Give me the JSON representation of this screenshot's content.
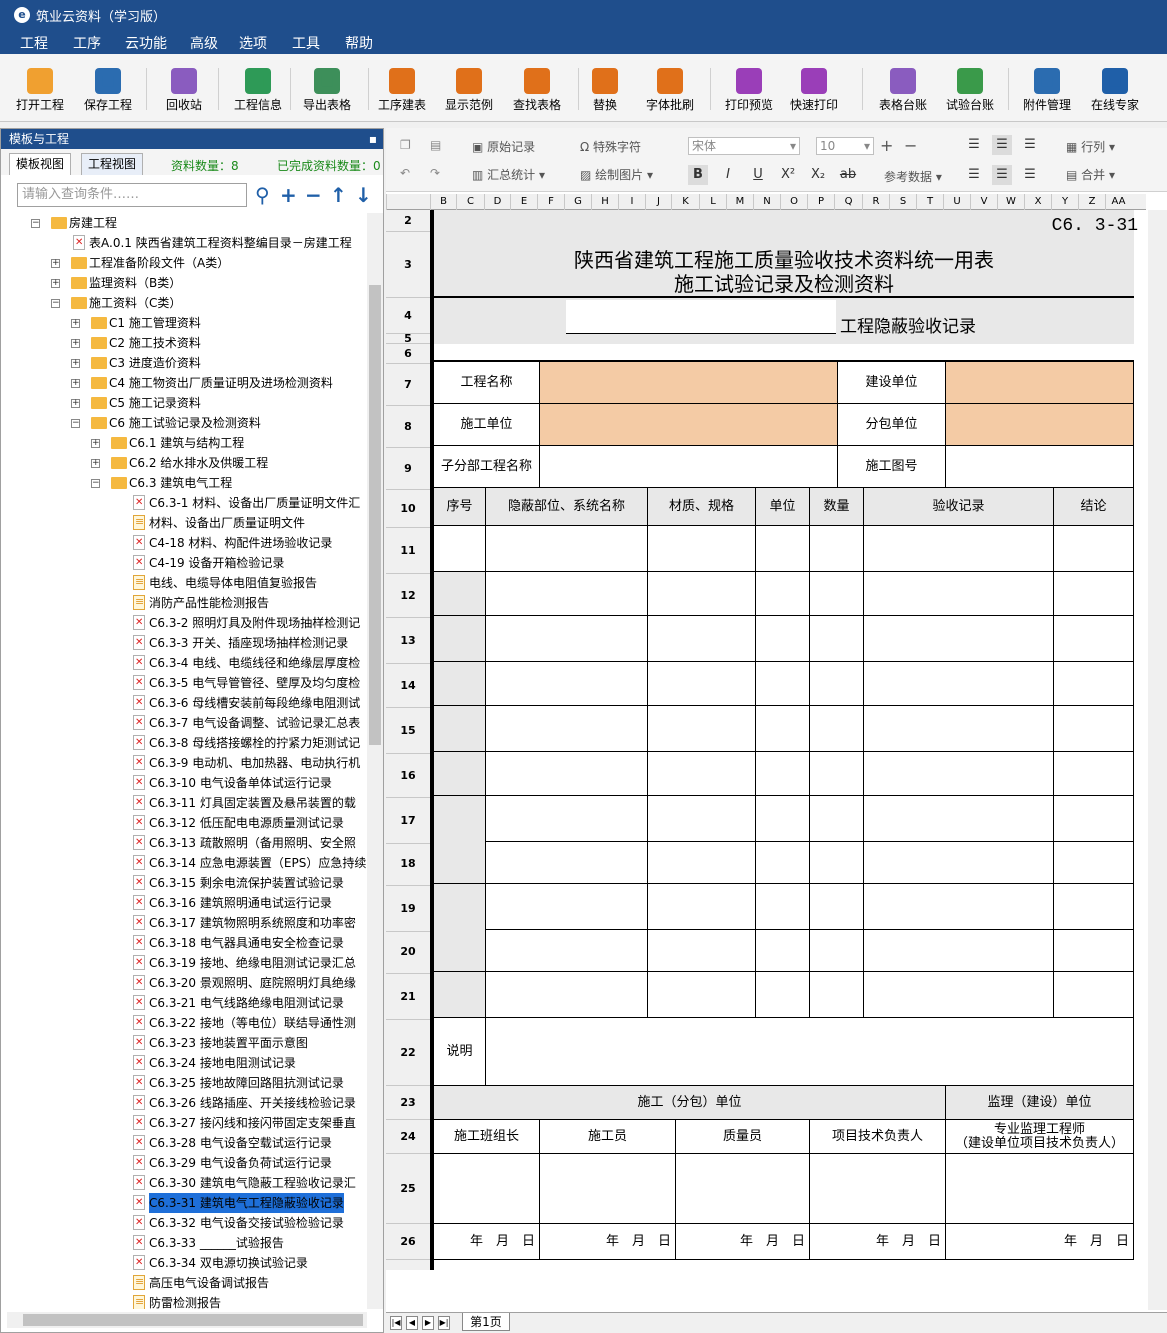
{
  "app_title": "筑业云资料（学习版）",
  "menu": [
    "工程",
    "工序",
    "云功能",
    "高级",
    "选项",
    "工具",
    "帮助"
  ],
  "toolbar": [
    {
      "label": "打开工程",
      "icon": "folder-open-icon",
      "color": "#f0a030"
    },
    {
      "label": "保存工程",
      "icon": "save-icon",
      "color": "#2b6cb0"
    },
    {
      "label": "回收站",
      "icon": "trash-icon",
      "color": "#8a5cbf"
    },
    {
      "label": "工程信息",
      "icon": "info-icon",
      "color": "#2e9a57"
    },
    {
      "label": "导出表格",
      "icon": "export-icon",
      "color": "#3d8f5a"
    },
    {
      "label": "工序建表",
      "icon": "layers-icon",
      "color": "#e0701a"
    },
    {
      "label": "显示范例",
      "icon": "example-icon",
      "color": "#e0701a"
    },
    {
      "label": "查找表格",
      "icon": "search-table-icon",
      "color": "#e0701a"
    },
    {
      "label": "替换",
      "icon": "replace-icon",
      "color": "#e0701a"
    },
    {
      "label": "字体批刷",
      "icon": "font-brush-icon",
      "color": "#e0701a"
    },
    {
      "label": "打印预览",
      "icon": "preview-icon",
      "color": "#9a3eb8"
    },
    {
      "label": "快速打印",
      "icon": "print-icon",
      "color": "#9a3eb8"
    },
    {
      "label": "表格台账",
      "icon": "ledger-icon",
      "color": "#8a5cbf"
    },
    {
      "label": "试验台账",
      "icon": "test-ledger-icon",
      "color": "#3a9a4a"
    },
    {
      "label": "附件管理",
      "icon": "attachment-icon",
      "color": "#2b6cb0"
    },
    {
      "label": "在线专家",
      "icon": "expert-icon",
      "color": "#1f5fa8"
    }
  ],
  "left_panel": {
    "title": "模板与工程",
    "tabs": [
      "模板视图",
      "工程视图"
    ],
    "count1": "资料数量：8",
    "count2": "已完成资料数量：0",
    "search_placeholder": "请输入查询条件……"
  },
  "tree": [
    {
      "lvl": 2,
      "type": "folder",
      "exp": "−",
      "text": "房建工程"
    },
    {
      "lvl": 3,
      "type": "docx",
      "text": "表A.0.1 陕西省建筑工程资料整编目录－房建工程"
    },
    {
      "lvl": 3,
      "type": "folder",
      "exp": "+",
      "text": "工程准备阶段文件（A类）"
    },
    {
      "lvl": 3,
      "type": "folder",
      "exp": "+",
      "text": "监理资料（B类）"
    },
    {
      "lvl": 3,
      "type": "folder",
      "exp": "−",
      "text": "施工资料（C类）"
    },
    {
      "lvl": 4,
      "type": "folder",
      "exp": "+",
      "text": "C1 施工管理资料"
    },
    {
      "lvl": 4,
      "type": "folder",
      "exp": "+",
      "text": "C2 施工技术资料"
    },
    {
      "lvl": 4,
      "type": "folder",
      "exp": "+",
      "text": "C3 进度造价资料"
    },
    {
      "lvl": 4,
      "type": "folder",
      "exp": "+",
      "text": "C4 施工物资出厂质量证明及进场检测资料"
    },
    {
      "lvl": 4,
      "type": "folder",
      "exp": "+",
      "text": "C5 施工记录资料"
    },
    {
      "lvl": 4,
      "type": "folder",
      "exp": "−",
      "text": "C6 施工试验记录及检测资料"
    },
    {
      "lvl": 5,
      "type": "folder",
      "exp": "+",
      "text": "C6.1 建筑与结构工程"
    },
    {
      "lvl": 5,
      "type": "folder",
      "exp": "+",
      "text": "C6.2 给水排水及供暖工程"
    },
    {
      "lvl": 5,
      "type": "folder",
      "exp": "−",
      "text": "C6.3 建筑电气工程"
    },
    {
      "lvl": 6,
      "type": "docx",
      "text": "C6.3-1 材料、设备出厂质量证明文件汇"
    },
    {
      "lvl": 6,
      "type": "docy",
      "text": "材料、设备出厂质量证明文件"
    },
    {
      "lvl": 6,
      "type": "docx",
      "text": "C4-18 材料、构配件进场验收记录"
    },
    {
      "lvl": 6,
      "type": "docx",
      "text": "C4-19 设备开箱检验记录"
    },
    {
      "lvl": 6,
      "type": "docy",
      "text": "电线、电缆导体电阻值复验报告"
    },
    {
      "lvl": 6,
      "type": "docy",
      "text": "消防产品性能检测报告"
    },
    {
      "lvl": 6,
      "type": "docx",
      "text": "C6.3-2 照明灯具及附件现场抽样检测记"
    },
    {
      "lvl": 6,
      "type": "docx",
      "text": "C6.3-3 开关、插座现场抽样检测记录"
    },
    {
      "lvl": 6,
      "type": "docx",
      "text": "C6.3-4 电线、电缆线径和绝缘层厚度检"
    },
    {
      "lvl": 6,
      "type": "docx",
      "text": "C6.3-5 电气导管管径、壁厚及均匀度检"
    },
    {
      "lvl": 6,
      "type": "docx",
      "text": "C6.3-6 母线槽安装前每段绝缘电阻测试"
    },
    {
      "lvl": 6,
      "type": "docx",
      "text": "C6.3-7 电气设备调整、试验记录汇总表"
    },
    {
      "lvl": 6,
      "type": "docx",
      "text": "C6.3-8 母线搭接螺栓的拧紧力矩测试记"
    },
    {
      "lvl": 6,
      "type": "docx",
      "text": "C6.3-9 电动机、电加热器、电动执行机"
    },
    {
      "lvl": 6,
      "type": "docx",
      "text": "C6.3-10 电气设备单体试运行记录"
    },
    {
      "lvl": 6,
      "type": "docx",
      "text": "C6.3-11 灯具固定装置及悬吊装置的载"
    },
    {
      "lvl": 6,
      "type": "docx",
      "text": "C6.3-12 低压配电电源质量测试记录"
    },
    {
      "lvl": 6,
      "type": "docx",
      "text": "C6.3-13 疏散照明（备用照明、安全照"
    },
    {
      "lvl": 6,
      "type": "docx",
      "text": "C6.3-14 应急电源装置（EPS）应急持续"
    },
    {
      "lvl": 6,
      "type": "docx",
      "text": "C6.3-15 剩余电流保护装置试验记录"
    },
    {
      "lvl": 6,
      "type": "docx",
      "text": "C6.3-16 建筑照明通电试运行记录"
    },
    {
      "lvl": 6,
      "type": "docx",
      "text": "C6.3-17 建筑物照明系统照度和功率密"
    },
    {
      "lvl": 6,
      "type": "docx",
      "text": "C6.3-18 电气器具通电安全检查记录"
    },
    {
      "lvl": 6,
      "type": "docx",
      "text": "C6.3-19 接地、绝缘电阻测试记录汇总"
    },
    {
      "lvl": 6,
      "type": "docx",
      "text": "C6.3-20 景观照明、庭院照明灯具绝缘"
    },
    {
      "lvl": 6,
      "type": "docx",
      "text": "C6.3-21 电气线路绝缘电阻测试记录"
    },
    {
      "lvl": 6,
      "type": "docx",
      "text": "C6.3-22 接地（等电位）联结导通性测"
    },
    {
      "lvl": 6,
      "type": "docx",
      "text": "C6.3-23 接地装置平面示意图"
    },
    {
      "lvl": 6,
      "type": "docx",
      "text": "C6.3-24 接地电阻测试记录"
    },
    {
      "lvl": 6,
      "type": "docx",
      "text": "C6.3-25 接地故障回路阻抗测试记录"
    },
    {
      "lvl": 6,
      "type": "docx",
      "text": "C6.3-26 线路插座、开关接线检验记录"
    },
    {
      "lvl": 6,
      "type": "docx",
      "text": "C6.3-27 接闪线和接闪带固定支架垂直"
    },
    {
      "lvl": 6,
      "type": "docx",
      "text": "C6.3-28 电气设备空载试运行记录"
    },
    {
      "lvl": 6,
      "type": "docx",
      "text": "C6.3-29 电气设备负荷试运行记录"
    },
    {
      "lvl": 6,
      "type": "docx",
      "text": "C6.3-30 建筑电气隐蔽工程验收记录汇"
    },
    {
      "lvl": 6,
      "type": "docx",
      "text": "C6.3-31 建筑电气工程隐蔽验收记录",
      "selected": true
    },
    {
      "lvl": 6,
      "type": "docx",
      "text": "C6.3-32 电气设备交接试验检验记录"
    },
    {
      "lvl": 6,
      "type": "docx",
      "text": "C6.3-33 ______试验报告"
    },
    {
      "lvl": 6,
      "type": "docx",
      "text": "C6.3-34 双电源切换试验记录"
    },
    {
      "lvl": 6,
      "type": "docy",
      "text": "高压电气设备调试报告"
    },
    {
      "lvl": 6,
      "type": "docy",
      "text": "防雷检测报告"
    }
  ],
  "ribbon": {
    "original": "原始记录",
    "special": "特殊字符",
    "summary": "汇总统计",
    "draw": "绘制图片",
    "font": "宋体",
    "size": "10",
    "refdata": "参考数据",
    "rowcol": "行列",
    "merge": "合并",
    "bold": "B",
    "italic": "I",
    "underline": "U",
    "sup": "X²",
    "sub": "X₂",
    "strike": "ab"
  },
  "columns": [
    "B",
    "C",
    "D",
    "E",
    "F",
    "G",
    "H",
    "I",
    "J",
    "K",
    "L",
    "M",
    "N",
    "O",
    "P",
    "Q",
    "R",
    "S",
    "T",
    "U",
    "V",
    "W",
    "X",
    "Y",
    "Z",
    "AA"
  ],
  "form": {
    "code": "C6. 3-31",
    "title1": "陕西省建筑工程施工质量验收技术资料统一用表",
    "title2": "施工试验记录及检测资料",
    "subtitle": "工程隐蔽验收记录",
    "project_name": "工程名称",
    "build_unit": "建设单位",
    "construct_unit": "施工单位",
    "sub_unit": "分包单位",
    "sub_project": "子分部工程名称",
    "drawing_no": "施工图号",
    "headers": [
      "序号",
      "隐蔽部位、系统名称",
      "材质、规格",
      "单位",
      "数量",
      "验收记录",
      "结论"
    ],
    "note": "说明",
    "sign_construct": "施工（分包）单位",
    "sign_supervise": "监理（建设）单位",
    "team_leader": "施工班组长",
    "worker": "施工员",
    "quality": "质量员",
    "tech_leader": "项目技术负责人",
    "supervisor_1": "专业监理工程师",
    "supervisor_2": "（建设单位项目技术负责人）",
    "date": "年　月　日"
  },
  "sheet_tab": "第1页"
}
